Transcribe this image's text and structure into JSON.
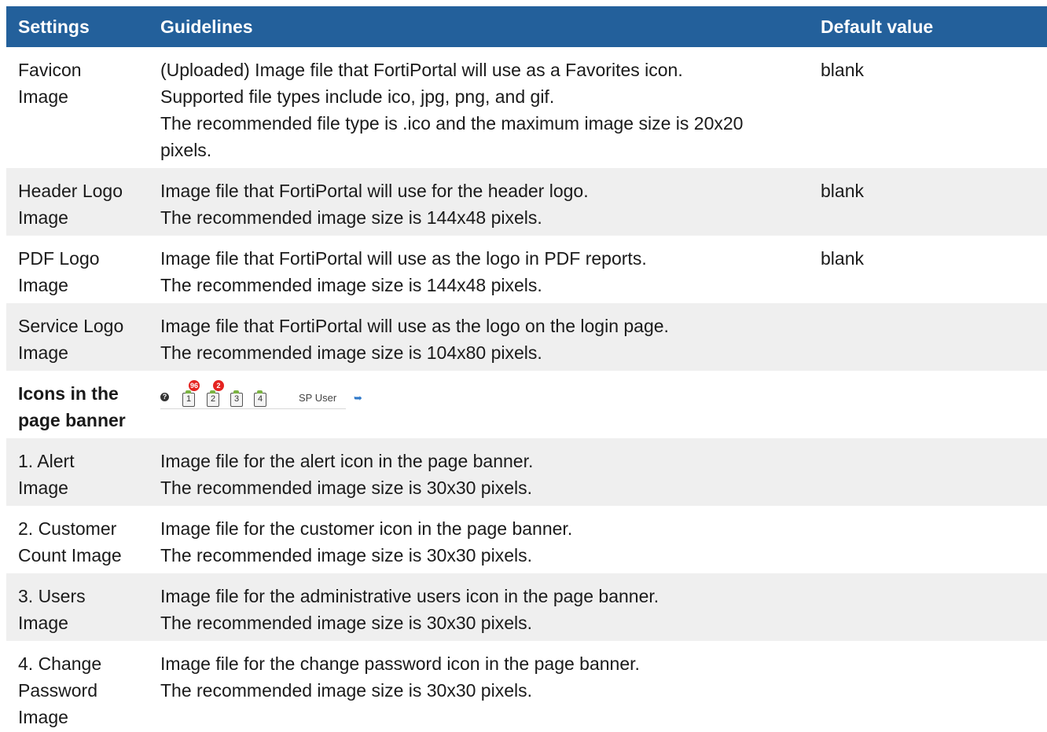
{
  "header": {
    "settings": "Settings",
    "guidelines": "Guidelines",
    "default": "Default value"
  },
  "rows": [
    {
      "setting": [
        "Favicon",
        "Image"
      ],
      "guidelines": [
        "(Uploaded) Image file that FortiPortal will use as a Favorites icon.",
        "Supported file types include ico, jpg, png, and gif.",
        "The recommended file type is .ico and the maximum image size is 20x20",
        "pixels."
      ],
      "default": "blank"
    },
    {
      "setting": [
        "Header Logo",
        "Image"
      ],
      "guidelines": [
        "Image file that FortiPortal will use for the header logo.",
        "The recommended image size is 144x48 pixels."
      ],
      "default": "blank"
    },
    {
      "setting": [
        "PDF Logo",
        "Image"
      ],
      "guidelines": [
        "Image file that FortiPortal will use as the logo in PDF reports.",
        "The recommended image size is 144x48 pixels."
      ],
      "default": "blank"
    },
    {
      "setting": [
        "Service Logo",
        "Image"
      ],
      "guidelines": [
        "Image file that FortiPortal will use as the logo on the login page.",
        "The recommended image size is 104x80 pixels."
      ],
      "default": ""
    },
    {
      "setting": [
        "Icons in the",
        "page banner"
      ],
      "banner": {
        "help_glyph": "?",
        "icons": [
          {
            "number": "1",
            "badge": "96",
            "icon": "alert-icon"
          },
          {
            "number": "2",
            "badge": "2",
            "icon": "customer-icon"
          },
          {
            "number": "3",
            "badge": "",
            "icon": "users-icon"
          },
          {
            "number": "4",
            "badge": "",
            "icon": "change-password-icon"
          }
        ],
        "user_label": "SP User",
        "logout_glyph": "➥"
      },
      "default": ""
    },
    {
      "setting": [
        "1. Alert",
        "Image"
      ],
      "guidelines": [
        "Image file for the alert icon in the page banner.",
        "The recommended image size is 30x30 pixels."
      ],
      "default": ""
    },
    {
      "setting": [
        "2. Customer",
        "Count Image"
      ],
      "guidelines": [
        "Image file for the customer icon in the page banner.",
        "The recommended image size is 30x30 pixels."
      ],
      "default": ""
    },
    {
      "setting": [
        "3. Users",
        "Image"
      ],
      "guidelines": [
        "Image file for the administrative users icon in the page banner.",
        "The recommended image size is 30x30 pixels."
      ],
      "default": ""
    },
    {
      "setting": [
        "4. Change",
        "Password",
        "Image"
      ],
      "guidelines": [
        "Image file for the change password icon in the page banner.",
        "The recommended image size is 30x30 pixels."
      ],
      "default": ""
    }
  ],
  "colors": {
    "header_bg": "#23609b",
    "stripe_bg": "#efefef",
    "badge_red": "#e52421"
  }
}
